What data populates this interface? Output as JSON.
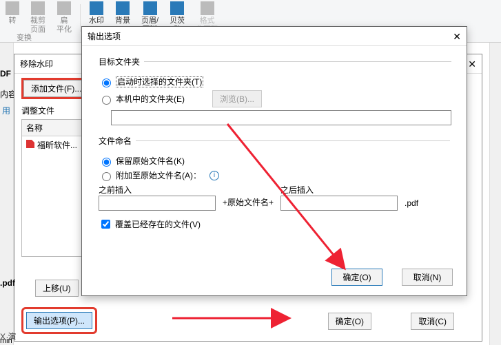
{
  "ribbon": {
    "items": [
      {
        "label": "转",
        "sub": ""
      },
      {
        "label": "裁剪\n页面",
        "sub": ""
      },
      {
        "label": "扁\n平化",
        "sub": ""
      },
      {
        "label": "水印",
        "sub": ""
      },
      {
        "label": "背景",
        "sub": ""
      },
      {
        "label": "页眉/\n页脚",
        "sub": ""
      },
      {
        "label": "贝茨\n数",
        "sub": ""
      },
      {
        "label": "格式\n化页码",
        "sub": ""
      }
    ],
    "group_sub": "变换"
  },
  "left": {
    "tab": "用"
  },
  "dlg1": {
    "title": "移除水印",
    "add_file": "添加文件(F)...",
    "adjust": "调整文件",
    "col_name": "名称",
    "file1": "福昕软件...",
    "move_up": "上移(U)",
    "output_opts": "输出选项(P)...",
    "ok": "确定(O)",
    "cancel": "取消(C)"
  },
  "dlg2": {
    "title": "输出选项",
    "grp_target": "目标文件夹",
    "opt_launch": "启动时选择的文件夹(T)",
    "opt_local": "本机中的文件夹(E)",
    "browse": "浏览(B)...",
    "path": "",
    "grp_naming": "文件命名",
    "opt_keep": "保留原始文件名(K)",
    "opt_append": "附加至原始文件名(A)：",
    "before_label": "之前插入",
    "before": "",
    "mid": "+原始文件名+",
    "after_label": "之后插入",
    "after": "",
    "ext": ".pdf",
    "overwrite": "覆盖已经存在的文件(V)",
    "ok": "确定(O)",
    "cancel": "取消(N)"
  },
  "misc": {
    "pdf_tab": ".pdf",
    "pres": "X 演",
    "min": "min"
  }
}
